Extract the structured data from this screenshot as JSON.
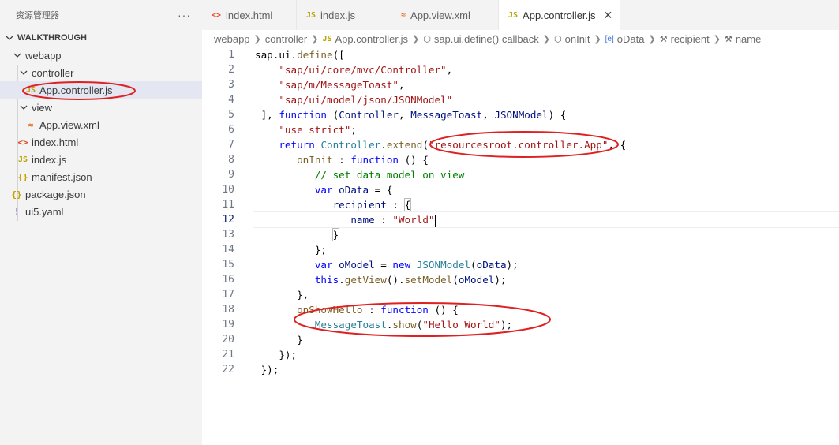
{
  "sidebar": {
    "title": "资源管理器",
    "more": "···",
    "root": "WALKTHROUGH",
    "items": [
      {
        "label": "webapp",
        "type": "folder"
      },
      {
        "label": "controller",
        "type": "folder"
      },
      {
        "label": "App.controller.js",
        "type": "js",
        "icon": "JS"
      },
      {
        "label": "view",
        "type": "folder"
      },
      {
        "label": "App.view.xml",
        "type": "xml",
        "icon": "≈"
      },
      {
        "label": "index.html",
        "type": "html",
        "icon": "<>"
      },
      {
        "label": "index.js",
        "type": "js",
        "icon": "JS"
      },
      {
        "label": "manifest.json",
        "type": "json",
        "icon": "{}"
      },
      {
        "label": "package.json",
        "type": "json",
        "icon": "{}"
      },
      {
        "label": "ui5.yaml",
        "type": "yaml",
        "icon": "!"
      }
    ]
  },
  "tabs": [
    {
      "label": "index.html",
      "icon": "<>"
    },
    {
      "label": "index.js",
      "icon": "JS"
    },
    {
      "label": "App.view.xml",
      "icon": "≈"
    },
    {
      "label": "App.controller.js",
      "icon": "JS",
      "close": "✕"
    }
  ],
  "breadcrumb": {
    "items": [
      "webapp",
      "controller",
      "App.controller.js",
      "sap.ui.define() callback",
      "onInit",
      "oData",
      "recipient",
      "name"
    ],
    "icons": [
      "",
      "",
      "JS",
      "⬡",
      "⬡",
      "[e]",
      "⚒",
      "⚒"
    ]
  },
  "editor": {
    "line_numbers": [
      "1",
      "2",
      "3",
      "4",
      "5",
      "6",
      "7",
      "8",
      "9",
      "10",
      "11",
      "12",
      "13",
      "14",
      "15",
      "16",
      "17",
      "18",
      "19",
      "20",
      "21",
      "22"
    ],
    "current_line": 12
  },
  "colors": {
    "annotation": "#e02020",
    "keyword": "#0000ff",
    "string": "#a31515",
    "comment": "#008000"
  }
}
